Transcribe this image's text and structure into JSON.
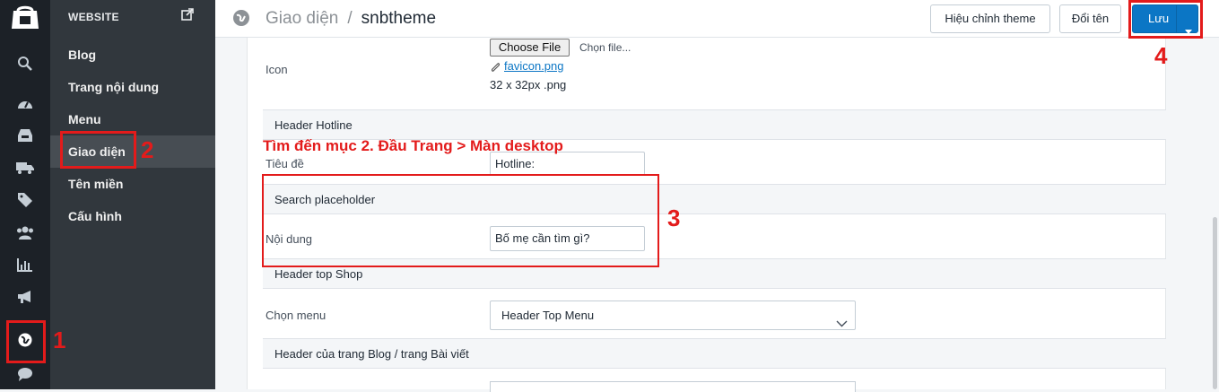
{
  "rail": {
    "icons": [
      "store-logo-icon",
      "search-icon",
      "dashboard-icon",
      "inbox-icon",
      "truck-icon",
      "tags-icon",
      "users-icon",
      "bar-chart-icon",
      "megaphone-icon",
      "globe-icon",
      "chat-icon"
    ]
  },
  "sidebar": {
    "heading": "WEBSITE",
    "items": [
      {
        "label": "Blog"
      },
      {
        "label": "Trang nội dung"
      },
      {
        "label": "Menu"
      },
      {
        "label": "Giao diện"
      },
      {
        "label": "Tên miền"
      },
      {
        "label": "Cấu hình"
      }
    ]
  },
  "header": {
    "breadcrumb_parent": "Giao diện",
    "breadcrumb_sep": "/",
    "breadcrumb_current": "snbtheme",
    "edit_theme_label": "Hiệu chỉnh theme",
    "rename_label": "Đổi tên",
    "save_label": "Lưu"
  },
  "form": {
    "icon_label": "Icon",
    "choose_file_label": "Choose File",
    "no_file_text": "Chọn file...",
    "file_name": "favicon.png",
    "file_hint": "32 x 32px .png",
    "sections": [
      {
        "title": "Header Hotline",
        "field_label": "Tiêu đề",
        "value": "Hotline:"
      },
      {
        "title": "Search placeholder",
        "field_label": "Nội dung",
        "value": "Bố mẹ cần tìm gì?"
      },
      {
        "title": "Header top Shop",
        "field_label": "Chọn menu",
        "value": "Header Top Menu"
      },
      {
        "title": "Header của trang Blog / trang Bài viết"
      }
    ]
  },
  "annotations": {
    "n1": "1",
    "n2": "2",
    "n3": "3",
    "n4": "4",
    "note": "Tìm đến mục 2. Đầu Trang > Màn desktop",
    "color": "#e31b1b"
  },
  "colors": {
    "rail_bg": "#1c2127",
    "sidebar_bg": "#31373d",
    "primary": "#0b76c5"
  }
}
